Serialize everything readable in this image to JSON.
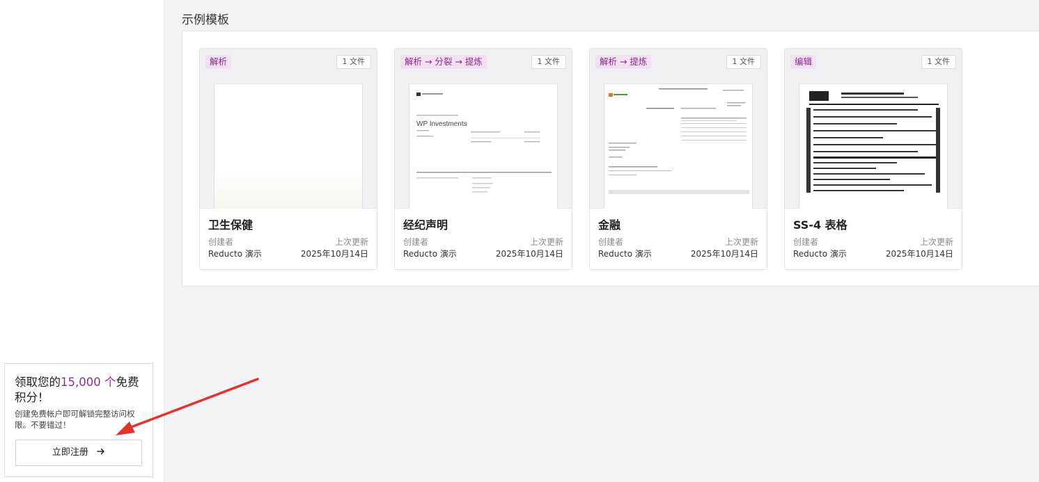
{
  "section": {
    "title": "示例模板"
  },
  "cards": [
    {
      "tag": "解析",
      "files": "1 文件",
      "name": "卫生保健",
      "created_label": "创建者",
      "creator": "Reducto 演示",
      "updated_label": "上次更新",
      "updated": "2025年10月14日"
    },
    {
      "tag": "解析 → 分裂 → 提炼",
      "files": "1 文件",
      "name": "经纪声明",
      "created_label": "创建者",
      "creator": "Reducto 演示",
      "updated_label": "上次更新",
      "updated": "2025年10月14日",
      "doc_heading": "WP Investments"
    },
    {
      "tag": "解析 → 提炼",
      "files": "1 文件",
      "name": "金融",
      "created_label": "创建者",
      "creator": "Reducto 演示",
      "updated_label": "上次更新",
      "updated": "2025年10月14日"
    },
    {
      "tag": "编辑",
      "files": "1 文件",
      "name": "SS-4 表格",
      "created_label": "创建者",
      "creator": "Reducto 演示",
      "updated_label": "上次更新",
      "updated": "2025年10月14日"
    }
  ],
  "promo": {
    "title_prefix": "领取您的",
    "title_highlight": "15,000 个",
    "title_suffix": "免费积分！",
    "description": "创建免费帐户即可解锁完整访问权限。不要错过！",
    "button_label": "立即注册",
    "button_icon": "arrow-right-icon"
  },
  "colors": {
    "accent": "#8e2f8e",
    "tag_bg": "#f3e1f3",
    "annotation_arrow": "#e5332a"
  }
}
